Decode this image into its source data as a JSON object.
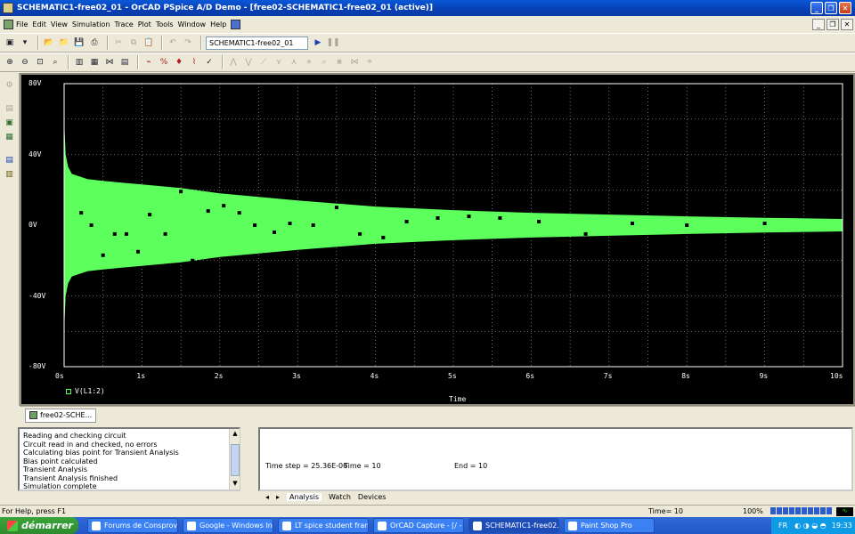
{
  "window": {
    "title": "SCHEMATIC1-free02_01 - OrCAD PSpice A/D Demo  - [free02-SCHEMATIC1-free02_01 (active)]"
  },
  "menu": [
    "File",
    "Edit",
    "View",
    "Simulation",
    "Trace",
    "Plot",
    "Tools",
    "Window",
    "Help"
  ],
  "toolbar": {
    "profile_value": "SCHEMATIC1-free02_01"
  },
  "plot": {
    "trace_label": "V(L1:2)",
    "x_title": "Time",
    "trace_color": "#5dff5d",
    "background": "#000000"
  },
  "chart_data": {
    "type": "line",
    "title": "",
    "xlabel": "Time",
    "ylabel": "",
    "xlim": [
      0,
      10
    ],
    "ylim": [
      -80,
      80
    ],
    "grid": true,
    "x_ticks": [
      "0s",
      "1s",
      "2s",
      "3s",
      "4s",
      "5s",
      "6s",
      "7s",
      "8s",
      "9s",
      "10s"
    ],
    "y_ticks": [
      "80V",
      "40V",
      "0V",
      "-40V",
      "-80V"
    ],
    "series": [
      {
        "name": "V(L1:2)",
        "envelope_time_s": [
          0.0,
          0.02,
          0.05,
          0.1,
          0.3,
          0.5,
          1.0,
          1.5,
          2.0,
          3.0,
          4.0,
          5.0,
          6.0,
          7.0,
          8.0,
          9.0,
          10.0
        ],
        "envelope_upper_V": [
          60,
          40,
          33,
          29,
          26,
          25,
          23,
          21,
          18,
          14,
          10.5,
          8.5,
          7,
          6,
          5,
          4.2,
          3.5
        ],
        "envelope_lower_V": [
          -60,
          -40,
          -33,
          -29,
          -26,
          -25,
          -23,
          -21,
          -18,
          -14,
          -10.5,
          -8.5,
          -7,
          -6,
          -5,
          -4.2,
          -3.5
        ],
        "markers": [
          {
            "t": 0.12,
            "v": 30
          },
          {
            "t": 0.22,
            "v": 7
          },
          {
            "t": 0.35,
            "v": 0
          },
          {
            "t": 0.5,
            "v": -17
          },
          {
            "t": 0.65,
            "v": -5
          },
          {
            "t": 0.8,
            "v": -5
          },
          {
            "t": 0.95,
            "v": -15
          },
          {
            "t": 1.1,
            "v": 6
          },
          {
            "t": 1.3,
            "v": -5
          },
          {
            "t": 1.5,
            "v": 19
          },
          {
            "t": 1.65,
            "v": -20
          },
          {
            "t": 1.85,
            "v": 8
          },
          {
            "t": 2.05,
            "v": 11
          },
          {
            "t": 2.25,
            "v": 7
          },
          {
            "t": 2.45,
            "v": 0
          },
          {
            "t": 2.7,
            "v": -4
          },
          {
            "t": 2.9,
            "v": 1
          },
          {
            "t": 3.2,
            "v": 0
          },
          {
            "t": 3.5,
            "v": 10
          },
          {
            "t": 3.8,
            "v": -5
          },
          {
            "t": 4.1,
            "v": -7
          },
          {
            "t": 4.4,
            "v": 2
          },
          {
            "t": 4.8,
            "v": 4
          },
          {
            "t": 5.2,
            "v": 5
          },
          {
            "t": 5.6,
            "v": 4
          },
          {
            "t": 6.1,
            "v": 2
          },
          {
            "t": 6.7,
            "v": -5
          },
          {
            "t": 7.3,
            "v": 1
          },
          {
            "t": 8.0,
            "v": 0
          },
          {
            "t": 9.0,
            "v": 1
          }
        ]
      }
    ]
  },
  "tabs": {
    "document": "free02-SCHE..."
  },
  "output_log": [
    "Reading and checking circuit",
    "Circuit read in and checked, no errors",
    "Calculating bias point for Transient Analysis",
    "Bias point calculated",
    "Transient Analysis",
    "Transient Analysis finished",
    "Simulation complete"
  ],
  "sim_status": {
    "time_step": "Time step =  25.36E-06",
    "time": "Time =  10",
    "end": "End =  10"
  },
  "pane_tabs": [
    "Analysis",
    "Watch",
    "Devices"
  ],
  "statusbar": {
    "help": "For Help, press F1",
    "time": "Time= 10",
    "zoom": "100%"
  },
  "taskbar": {
    "start": "démarrer",
    "tasks": [
      "Forums de Consprov...",
      "Google - Windows Int...",
      "LT spice student fran...",
      "OrCAD Capture - [/ - ...",
      "SCHEMATIC1-free02...",
      "Paint Shop Pro"
    ],
    "lang": "FR",
    "clock": "19:33"
  }
}
